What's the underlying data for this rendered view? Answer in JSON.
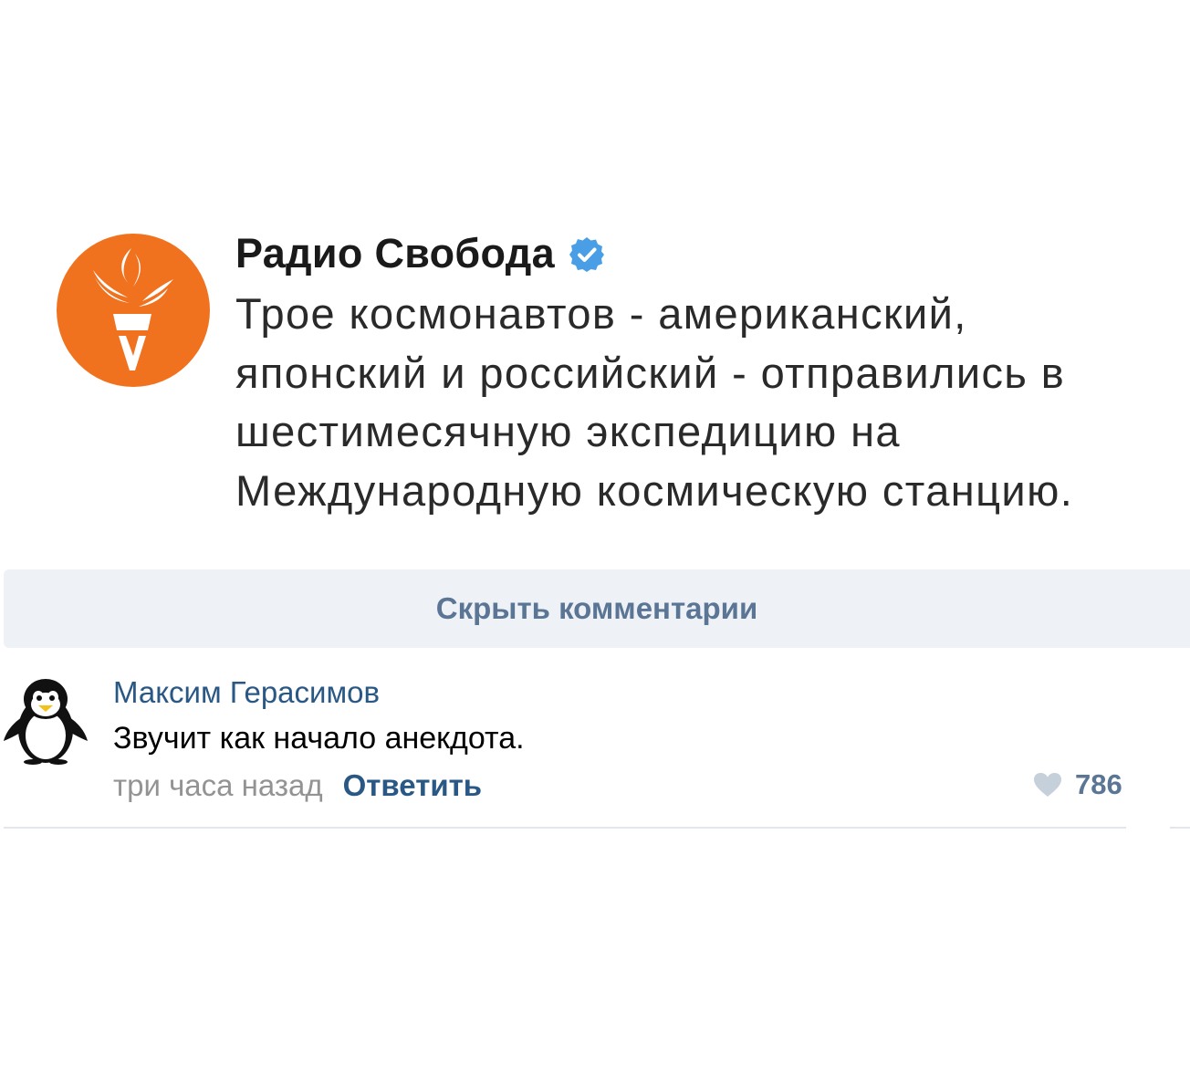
{
  "post": {
    "author": "Радио Свобода",
    "verified": true,
    "verified_icon": "verified-checkmark-icon",
    "avatar_icon": "radio-liberty-torch-logo",
    "avatar_color": "#f0721e",
    "text": "Трое космонавтов - американский, японский и российский - отправились в шестимесячную экспедицию на Международную космическую станцию."
  },
  "comments_bar": {
    "label": "Скрыть комментарии"
  },
  "comment": {
    "avatar_icon": "penguin-avatar",
    "author": "Максим Герасимов",
    "text": "Звучит как начало анекдота.",
    "time": "три часа назад",
    "reply_label": "Ответить",
    "like_icon": "heart-icon",
    "likes": "786"
  },
  "colors": {
    "link": "#2a5885",
    "muted": "#939393",
    "bar_bg": "#eef1f5",
    "bar_text": "#5b7595",
    "verified": "#4a9ee6"
  }
}
